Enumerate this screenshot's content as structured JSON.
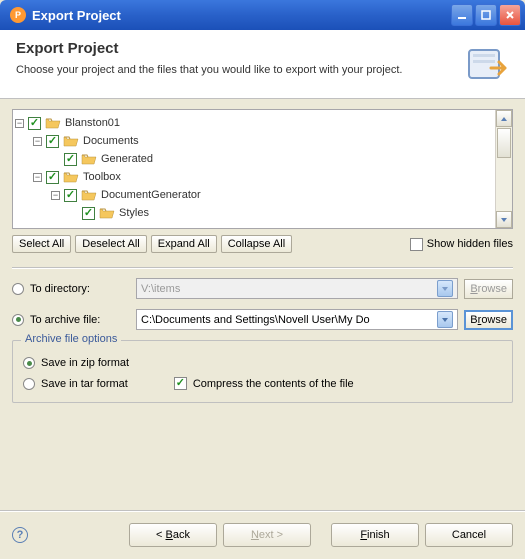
{
  "titlebar": {
    "text": "Export Project"
  },
  "header": {
    "title": "Export Project",
    "desc": "Choose your project and the files that you would like to export with your project."
  },
  "tree": {
    "items": [
      {
        "indent": 0,
        "expander": "-",
        "label": "Blanston01",
        "icon": "project"
      },
      {
        "indent": 1,
        "expander": "-",
        "label": "Documents",
        "icon": "folder"
      },
      {
        "indent": 2,
        "expander": "",
        "label": "Generated",
        "icon": "folder"
      },
      {
        "indent": 1,
        "expander": "-",
        "label": "Toolbox",
        "icon": "folder"
      },
      {
        "indent": 2,
        "expander": "-",
        "label": "DocumentGenerator",
        "icon": "folder"
      },
      {
        "indent": 3,
        "expander": "",
        "label": "Styles",
        "icon": "folder"
      }
    ]
  },
  "buttons": {
    "select_all": "Select All",
    "deselect_all": "Deselect All",
    "expand_all": "Expand All",
    "collapse_all": "Collapse All",
    "show_hidden": "Show hidden files"
  },
  "dest": {
    "to_directory": "To directory:",
    "to_archive": "To archive file:",
    "dir_value": "V:\\items",
    "archive_value": "C:\\Documents and Settings\\Novell User\\My Do",
    "browse": "Browse"
  },
  "options": {
    "legend": "Archive file options",
    "zip": "Save in zip format",
    "tar": "Save in tar format",
    "compress": "Compress the contents of the file"
  },
  "wizard": {
    "back": "Back",
    "next": "Next",
    "finish": "Finish",
    "cancel": "Cancel"
  }
}
